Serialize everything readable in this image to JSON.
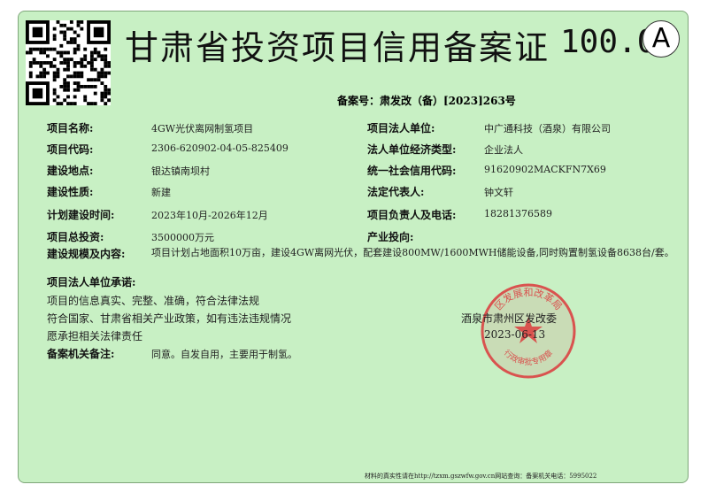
{
  "header": {
    "title": "甘肃省投资项目信用备案证",
    "score": "100.0",
    "grade": "A"
  },
  "filing_no": "备案号：肃发改（备）[2023]263号",
  "left_fields": [
    {
      "label": "项目名称:",
      "value": "4GW光伏离网制氢项目"
    },
    {
      "label": "项目代码:",
      "value": "2306-620902-04-05-825409"
    },
    {
      "label": "建设地点:",
      "value": "银达镇南坝村"
    },
    {
      "label": "建设性质:",
      "value": "新建"
    },
    {
      "label": "计划建设时间:",
      "value": "2023年10月-2026年12月"
    },
    {
      "label": "项目总投资:",
      "value": "3500000万元"
    }
  ],
  "right_fields": [
    {
      "label": "项目法人单位:",
      "value": "中广通科技（酒泉）有限公司"
    },
    {
      "label": "法人单位经济类型:",
      "value": "企业法人"
    },
    {
      "label": "统一社会信用代码:",
      "value": "91620902MACKFN7X69"
    },
    {
      "label": "法定代表人:",
      "value": "钟文轩"
    },
    {
      "label": "项目负责人及电话:",
      "value": "18281376589"
    },
    {
      "label": "产业投向:",
      "value": ""
    }
  ],
  "scale": {
    "label": "建设规模及内容:",
    "value": "项目计划占地面积10万亩，建设4GW离网光伏，配套建设800MW/1600MWH储能设备,同时购置制氢设备8638台/套。"
  },
  "promise": {
    "label": "项目法人单位承诺:",
    "lines": [
      "项目的信息真实、完整、准确，符合法律法规",
      "符合国家、甘肃省相关产业政策，如有违法违规情况",
      "愿承担相关法律责任"
    ]
  },
  "issuer": {
    "name": "酒泉市肃州区发改委",
    "date": "2023-06-13"
  },
  "stamp": {
    "text_top": "区发展和改革局",
    "text_bottom": "行政审批专用章",
    "color": "#d9534f"
  },
  "remarks": {
    "label": "备案机关备注:",
    "value": "同意。自发自用，主要用于制氢。"
  },
  "footer": "材料的真实性请在http://tzxm.gszwfw.gov.cn网站查询：备案机关电话：5995022",
  "colors": {
    "background": "#c8f0c4",
    "border": "#7fa67a"
  }
}
